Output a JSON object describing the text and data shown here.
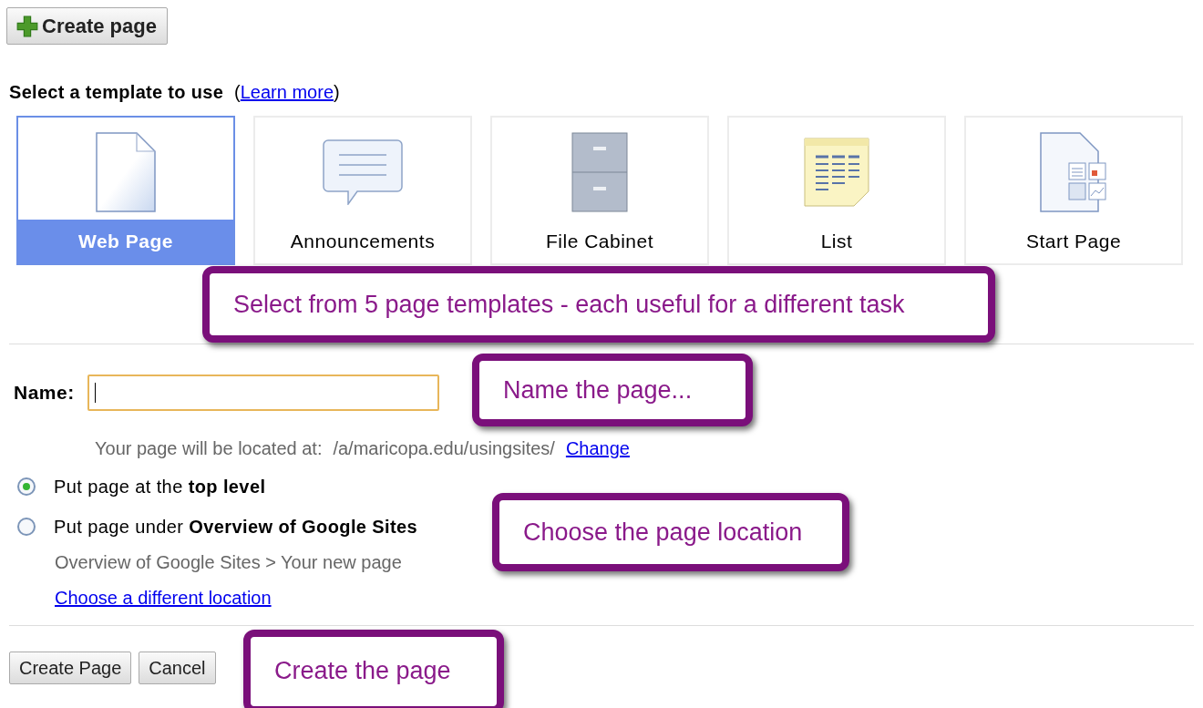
{
  "toolbar": {
    "create_button": "Create page"
  },
  "template_section": {
    "heading": "Select a template to use",
    "before": "(",
    "learn_more": "Learn more",
    "after": ")"
  },
  "templates": [
    {
      "label": "Web Page",
      "kind": "page",
      "selected": true
    },
    {
      "label": "Announcements",
      "kind": "announcements",
      "selected": false
    },
    {
      "label": "File Cabinet",
      "kind": "cabinet",
      "selected": false
    },
    {
      "label": "List",
      "kind": "list",
      "selected": false
    },
    {
      "label": "Start Page",
      "kind": "start",
      "selected": false
    }
  ],
  "name_field": {
    "label": "Name:",
    "focused": true
  },
  "location": {
    "prefix": "Your page will be located at:",
    "path": "/a/maricopa.edu/usingsites/",
    "change_link": "Change"
  },
  "placement": [
    {
      "label": "Put page at the **top level**",
      "selected": true
    },
    {
      "label": "Put page under **Overview of Google Sites**",
      "selected": false
    }
  ],
  "breadcrumb": "Overview of Google Sites > Your new page",
  "choose_link": "Choose a different location",
  "buttons": [
    "Create Page",
    "Cancel"
  ],
  "callouts": [
    "Select from 5 page templates - each useful for a different task",
    "Name the page...",
    "Choose the page location",
    "Create the page"
  ]
}
